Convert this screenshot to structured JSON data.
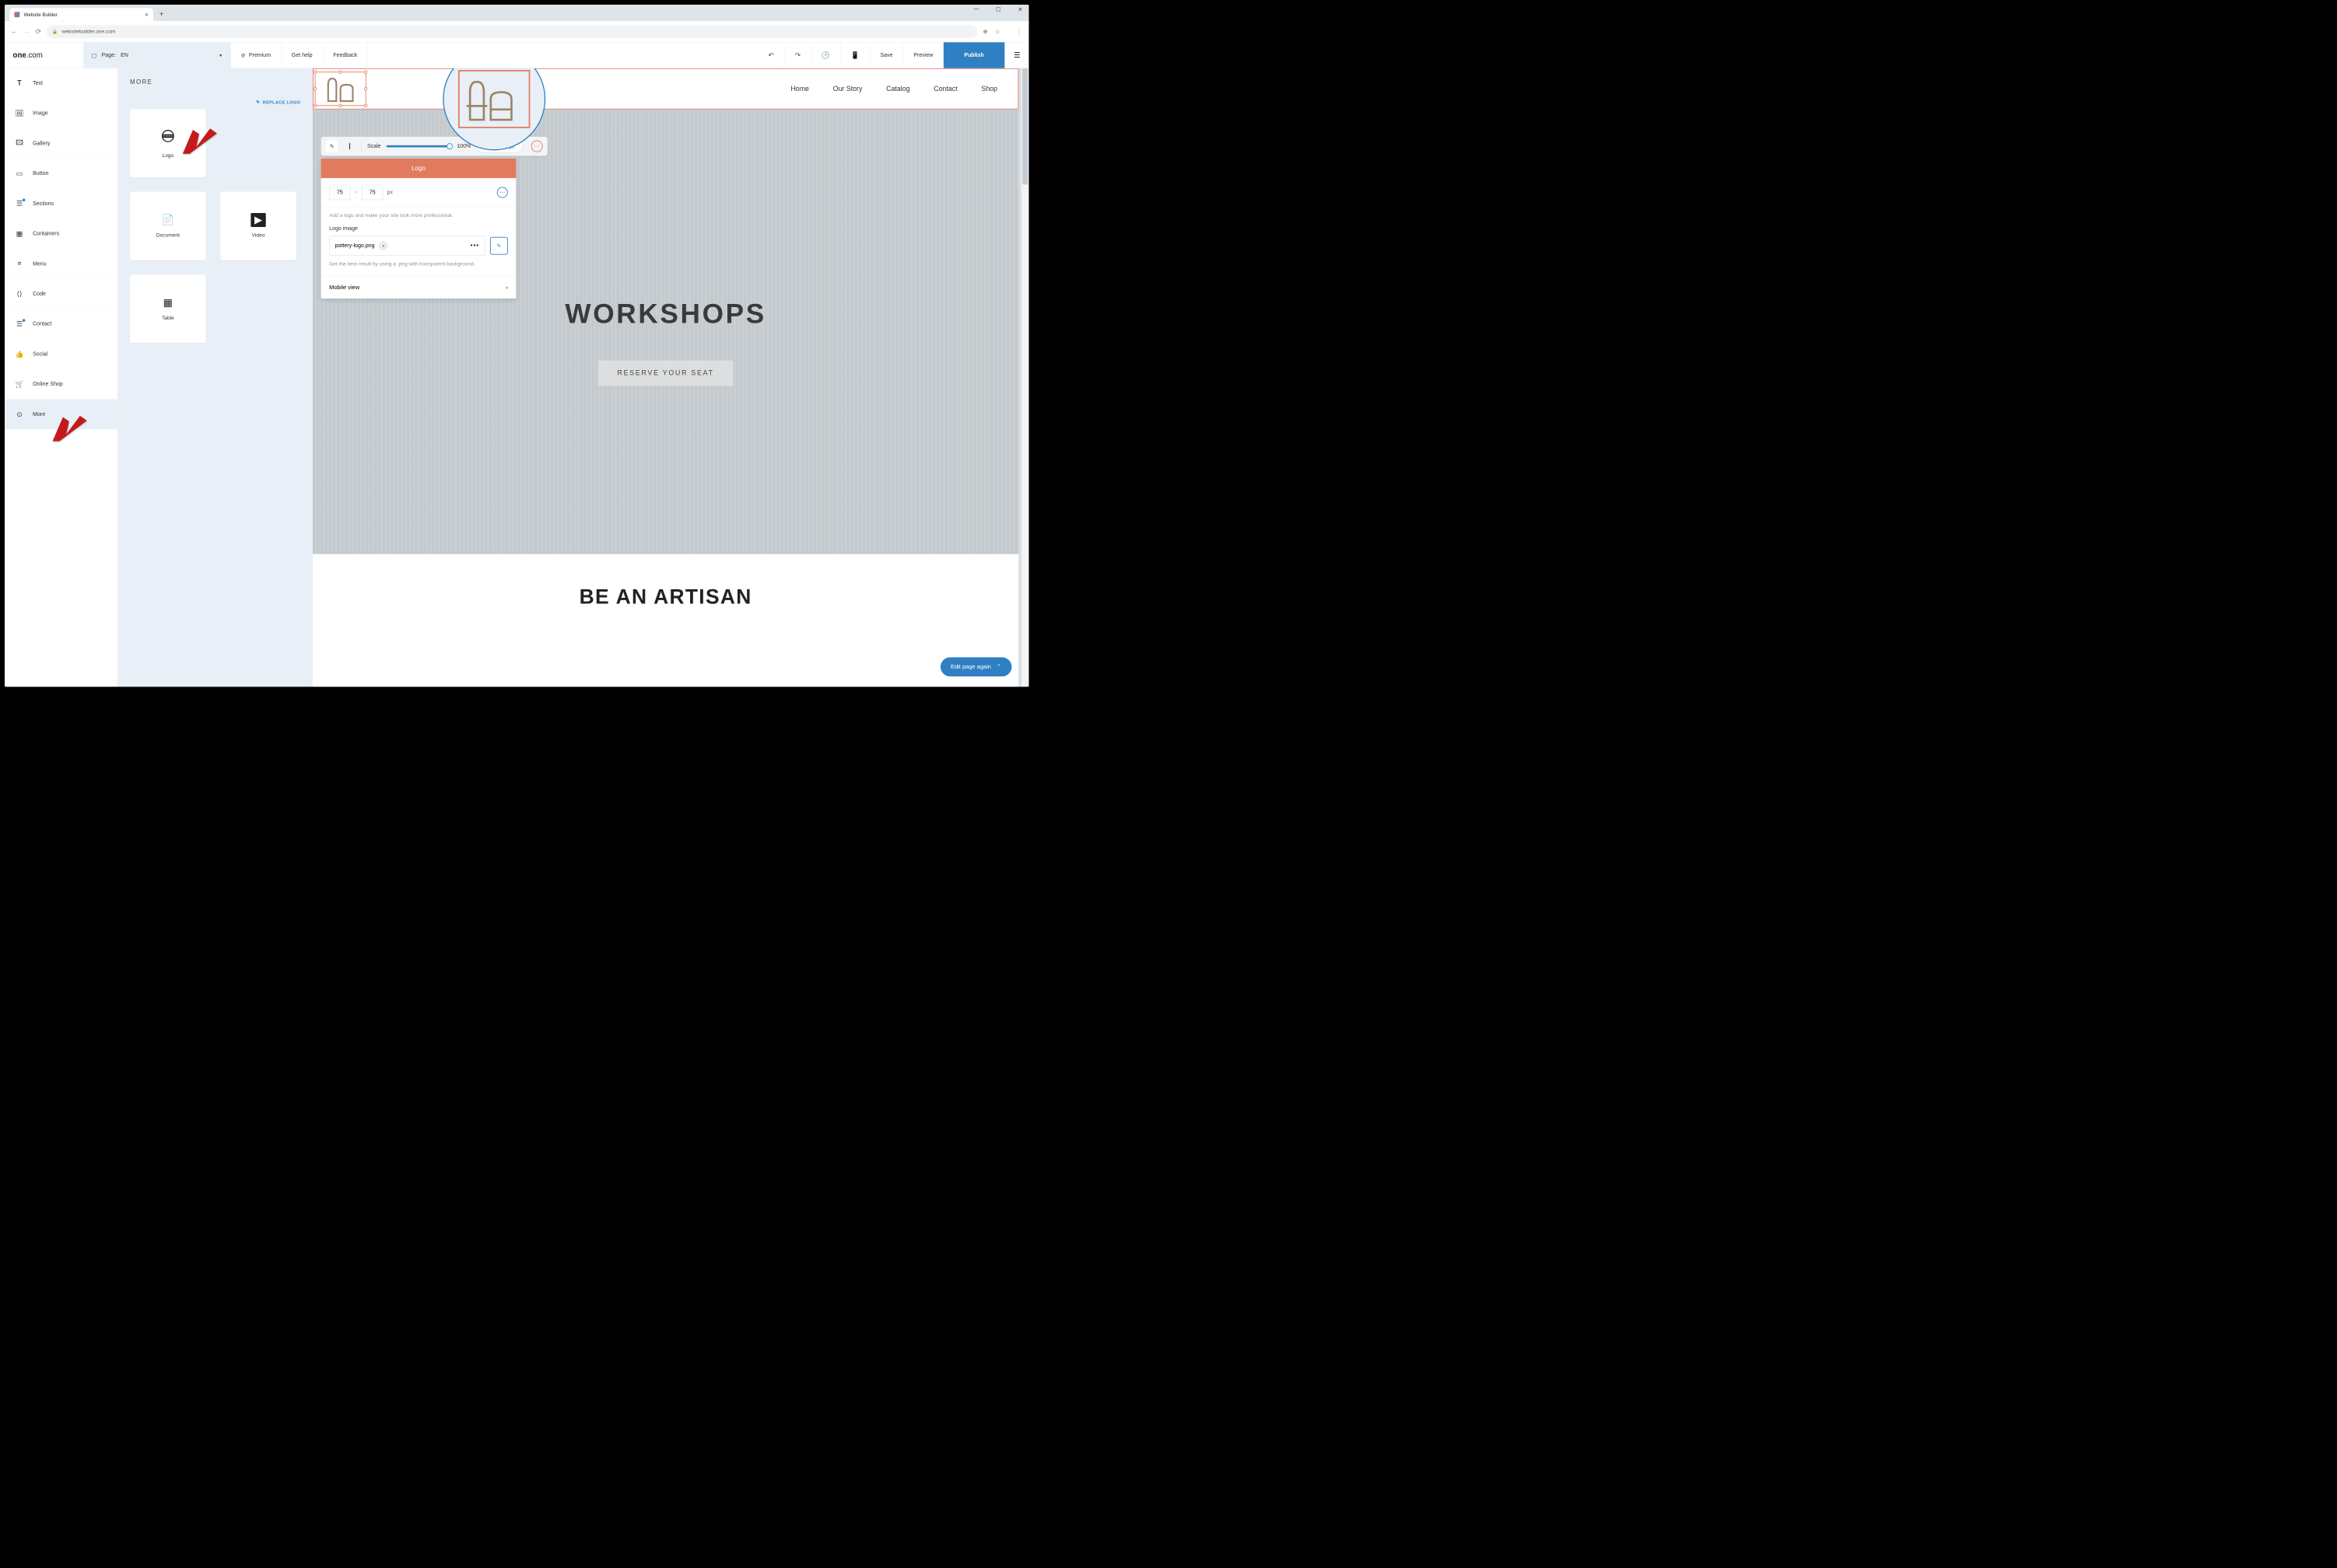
{
  "browser": {
    "tab_title": "Website Builder",
    "url": "websitebuilder.one.com"
  },
  "brand": "one.com",
  "page_selector": {
    "label": "Page:",
    "value": "EN"
  },
  "toolbar": {
    "premium": "Premium",
    "help": "Get help",
    "feedback": "Feedback",
    "save": "Save",
    "preview": "Preview",
    "publish": "Publish"
  },
  "sidebar1": [
    {
      "icon": "T",
      "label": "Text"
    },
    {
      "icon": "image",
      "label": "Image"
    },
    {
      "icon": "gallery",
      "label": "Gallery"
    },
    {
      "icon": "button",
      "label": "Button"
    },
    {
      "icon": "sections",
      "label": "Sections",
      "dot": true
    },
    {
      "icon": "containers",
      "label": "Containers"
    },
    {
      "icon": "menu",
      "label": "Menu"
    },
    {
      "icon": "code",
      "label": "Code"
    },
    {
      "icon": "contact",
      "label": "Contact",
      "dot": true
    },
    {
      "icon": "social",
      "label": "Social"
    },
    {
      "icon": "shop",
      "label": "Online Shop"
    },
    {
      "icon": "more",
      "label": "More",
      "active": true
    }
  ],
  "sidebar2": {
    "title": "MORE",
    "replace_link": "REPLACE LOGO",
    "tiles": [
      {
        "label": "Logo",
        "icon": "logo"
      },
      {
        "label": "Document",
        "icon": "doc"
      },
      {
        "label": "Video",
        "icon": "video"
      },
      {
        "label": "Table",
        "icon": "table"
      }
    ]
  },
  "float_toolbar": {
    "scale_label": "Scale",
    "scale_value": "100%",
    "replace": "Replace logo"
  },
  "logo_panel": {
    "title": "Logo",
    "w": "75",
    "h": "75",
    "unit": "px",
    "desc": "Add a logo and make your site look more professional.",
    "label": "Logo image",
    "filename": "pottery-logo.png",
    "hint": "Get the best result by using a .png with transparent background.",
    "mobile": "Mobile view"
  },
  "site": {
    "nav": [
      "Home",
      "Our Story",
      "Catalog",
      "Contact",
      "Shop"
    ],
    "hero_title": "WORKSHOPS",
    "hero_button": "RESERVE YOUR SEAT",
    "section2": "BE AN ARTISAN"
  },
  "edit_again": "Edit page again"
}
